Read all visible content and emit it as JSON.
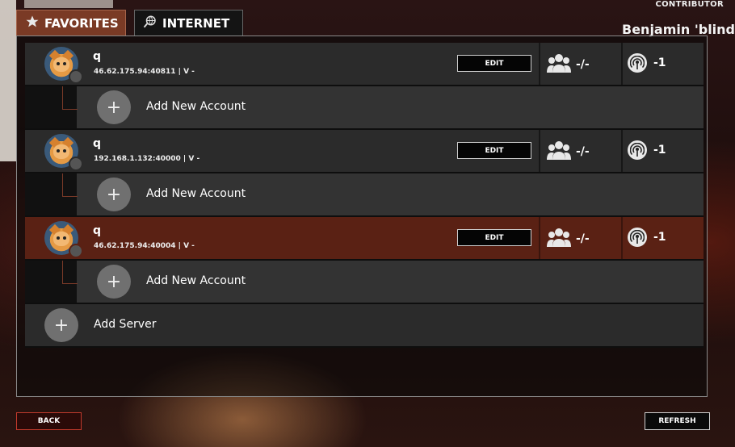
{
  "header": {
    "role_badge": "CONTRIBUTOR",
    "username": "Benjamin 'blindC"
  },
  "tabs": [
    {
      "label": "FAVORITES",
      "icon": "star-icon",
      "active": true
    },
    {
      "label": "INTERNET",
      "icon": "globe-search-icon",
      "active": false
    }
  ],
  "servers": [
    {
      "name": "q",
      "address": "46.62.175.94:40811 | V -",
      "edit_label": "EDIT",
      "players": "-/-",
      "ping": "-1",
      "add_account_label": "Add New Account"
    },
    {
      "name": "q",
      "address": "192.168.1.132:40000 | V -",
      "edit_label": "EDIT",
      "players": "-/-",
      "ping": "-1",
      "add_account_label": "Add New Account"
    },
    {
      "name": "q",
      "address": "46.62.175.94:40004 | V -",
      "edit_label": "EDIT",
      "players": "-/-",
      "ping": "-1",
      "add_account_label": "Add New Account",
      "selected": true
    }
  ],
  "add_server_label": "Add Server",
  "plus_symbol": "+",
  "footer": {
    "back_label": "BACK",
    "refresh_label": "REFRESH"
  },
  "colors": {
    "selected_row": "#5a2114",
    "active_tab": "#7a3a25",
    "back_border": "#c23a2c"
  }
}
